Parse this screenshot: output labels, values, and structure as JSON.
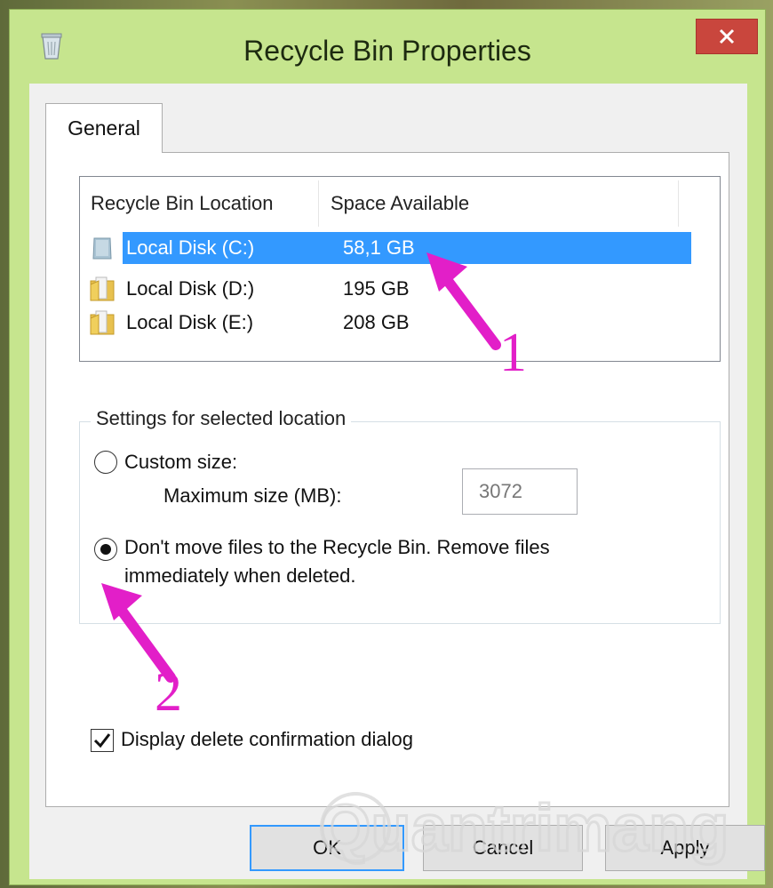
{
  "window": {
    "title": "Recycle Bin Properties",
    "icons": {
      "app": "recycle-bin-icon",
      "close": "close-icon"
    }
  },
  "tabs": [
    {
      "label": "General",
      "selected": true
    }
  ],
  "list": {
    "columns": [
      "Recycle Bin Location",
      "Space Available"
    ],
    "rows": [
      {
        "location": "Local Disk (C:)",
        "space": "58,1 GB",
        "selected": true,
        "icon": "drive-icon"
      },
      {
        "location": "Local Disk (D:)",
        "space": "195 GB",
        "selected": false,
        "icon": "folder-drive-icon"
      },
      {
        "location": "Local Disk (E:)",
        "space": "208 GB",
        "selected": false,
        "icon": "folder-drive-icon"
      }
    ]
  },
  "settings": {
    "group_title": "Settings for selected location",
    "custom_size_label": "Custom size:",
    "max_size_label": "Maximum size (MB):",
    "max_size_value": "3072",
    "dont_move_label_line1": "Don't move files to the Recycle Bin. Remove files",
    "dont_move_label_line2": "immediately when deleted.",
    "selected_option": "dont_move"
  },
  "confirm": {
    "label": "Display delete confirmation dialog",
    "checked": true
  },
  "buttons": {
    "ok": "OK",
    "cancel": "Cancel",
    "apply": "Apply"
  },
  "annotations": {
    "one": "1",
    "two": "2",
    "color": "#e21fc8"
  },
  "watermark": "Quantrimang",
  "colors": {
    "titlebar": "#c6e58e",
    "selection": "#3399ff",
    "close": "#c9463d"
  }
}
